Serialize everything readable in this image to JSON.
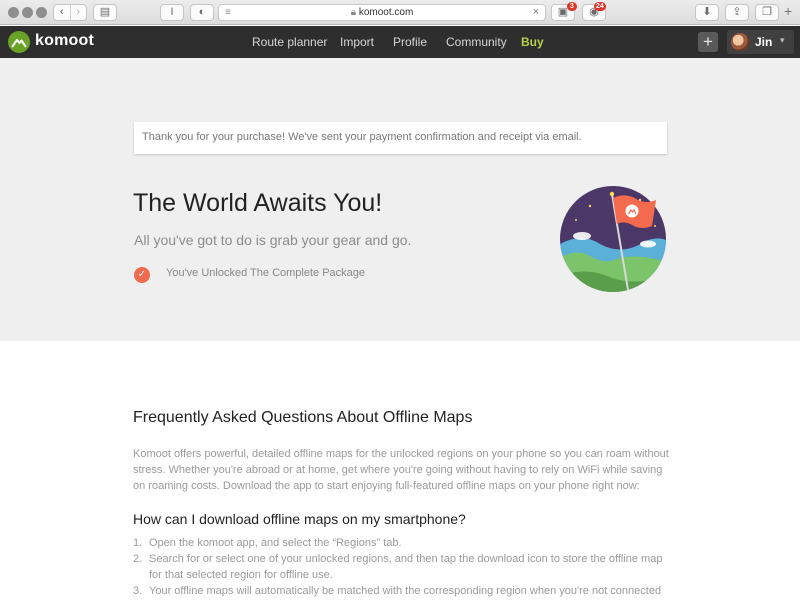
{
  "browser": {
    "url": "komoot.com",
    "badges": [
      "3",
      "24"
    ],
    "icons": {
      "back": "chevron-left-icon",
      "forward": "chevron-right-icon",
      "sidebar": "sidebar-icon",
      "reader": "reader-icon",
      "lock": "lock-icon",
      "close": "close-icon",
      "download": "download-icon",
      "share": "share-icon",
      "tabs": "tabs-icon",
      "new_tab": "plus-icon"
    }
  },
  "nav": {
    "brand": "komoot",
    "links": [
      "Route planner",
      "Import",
      "Profile",
      "Community"
    ],
    "buy": "Buy",
    "user": "Jin",
    "add_icon": "+",
    "caret": "▾"
  },
  "hero": {
    "notice": "Thank you for your purchase! We've sent your payment confirmation and receipt via email.",
    "title": "The World Awaits You!",
    "subtitle": "All you've got to do is grab your gear and go.",
    "check": "✓",
    "unlocked": "You've Unlocked The Complete Package"
  },
  "faq": {
    "title": "Frequently Asked Questions About Offline Maps",
    "intro": "Komoot offers powerful, detailed offline maps for the unlocked regions on your phone so you can roam without stress. Whether you're abroad or at home, get where you're going without having to rely on WiFi while saving on roaming costs. Download the app to start enjoying full-featured offline maps on your phone right now:",
    "question": "How can I download offline maps on my smartphone?",
    "steps": [
      {
        "num": "1.",
        "text": "Open the komoot app, and select the “Regions” tab."
      },
      {
        "num": "2.",
        "text": "Search for or select one of your unlocked regions, and then tap the download icon to store the offline map for that selected region for offline use."
      },
      {
        "num": "3.",
        "text": "Your offline maps will automatically be matched with the corresponding region when you're not connected"
      }
    ]
  },
  "colors": {
    "nav_bg": "#2e2e2e",
    "brand_green": "#6aa127",
    "buy_green": "#b3d24a",
    "hero_bg": "#efefef",
    "check_orange": "#f06a4d",
    "flag_orange": "#f46a4e",
    "sky_purple": "#4b3768"
  }
}
